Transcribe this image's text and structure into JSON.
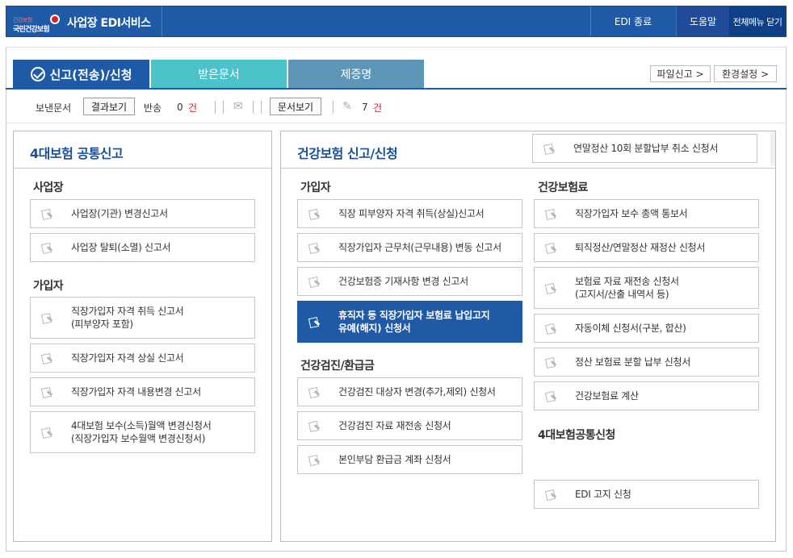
{
  "header": {
    "logo_small": "건강보험",
    "logo_name": "국민건강보험",
    "app_title": "사업장 EDI서비스",
    "edi_exit": "EDI 종료",
    "help": "도움말",
    "all_menu_close": "전체메뉴 닫기"
  },
  "tabs": [
    {
      "label": "신고(전송)/신청",
      "active": true
    },
    {
      "label": "받은문서",
      "active": false
    },
    {
      "label": "제증명",
      "active": false
    }
  ],
  "right_buttons": {
    "file_report": "파일신고 >",
    "settings": "환경설정 >"
  },
  "status": {
    "sent_docs_label": "보낸문서",
    "view_results": "결과보기",
    "returned_label": "반송",
    "returned_count": "0",
    "unit1": "건",
    "view_docs": "문서보기",
    "doc_count": "7",
    "unit2": "건"
  },
  "left_panel": {
    "title": "4대보험 공통신고",
    "sections": [
      {
        "title": "사업장",
        "items": [
          {
            "label": "사업장(기관) 변경신고서"
          },
          {
            "label": "사업장 탈퇴(소멸) 신고서"
          }
        ]
      },
      {
        "title": "가입자",
        "items": [
          {
            "label": "직장가입자 자격 취득 신고서\n(피부양자 포함)"
          },
          {
            "label": "직장가입자 자격 상실 신고서"
          },
          {
            "label": "직장가입자 자격 내용변경 신고서"
          },
          {
            "label": "4대보험 보수(소득)월액 변경신청서\n(직장가입자 보수월액 변경신청서)"
          }
        ]
      }
    ]
  },
  "right_panel": {
    "title": "건강보험 신고/신청",
    "top_item": "연말정산 10회 분할납부 취소 신청서",
    "col1": [
      {
        "title": "가입자",
        "items": [
          {
            "label": "직장 피부양자 자격 취득(상실)신고서"
          },
          {
            "label": "직장가입자 근무처(근무내용) 변동 신고서"
          },
          {
            "label": "건강보험증 기재사항 변경 신고서"
          },
          {
            "label": "휴직자 등 직장가입자 보험료 납입고지\n유예(해지) 신청서",
            "active": true
          }
        ]
      },
      {
        "title": "건강검진/환급금",
        "items": [
          {
            "label": "건강검진 대상자 변경(추가,제외) 신청서"
          },
          {
            "label": "건강검진 자료 재전송 신청서"
          },
          {
            "label": "본인부담 환급금 계좌 신청서"
          }
        ]
      }
    ],
    "col2": [
      {
        "title": "건강보험료",
        "items": [
          {
            "label": "직장가입자 보수 총액 통보서"
          },
          {
            "label": "퇴직정산/연말정산 재정산 신청서"
          },
          {
            "label": "보험료 자료 재전송 신청서\n(고지서/산출 내역서 등)"
          },
          {
            "label": "자동이체 신청서(구분, 합산)"
          },
          {
            "label": "정산 보험료 분할 납부 신청서"
          },
          {
            "label": "건강보험료 계산"
          }
        ]
      },
      {
        "title": "4대보험공통신청",
        "items": [
          {
            "label": "EDI 고지 신청"
          }
        ]
      }
    ]
  }
}
